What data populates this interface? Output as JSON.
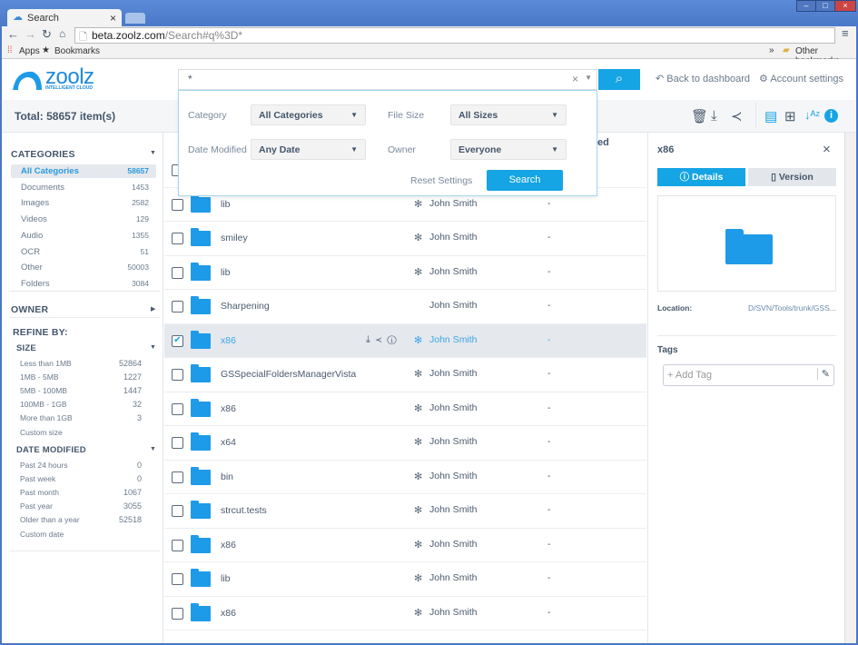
{
  "browser": {
    "tab_title": "Search",
    "url_host": "beta.zoolz.com",
    "url_path": "/Search#q%3D*",
    "bookmarks": [
      "Apps",
      "Bookmarks"
    ],
    "other_bookmarks": "Other bookmarks"
  },
  "header": {
    "logo": "zoolz",
    "logo_tag": "INTELLIGENT CLOUD",
    "search_value": "*",
    "back": "Back to dashboard",
    "account": "Account settings"
  },
  "toolbar": {
    "total_label": "Total:",
    "total_value": "58657 item(s)"
  },
  "filters": {
    "category_label": "Category",
    "category_value": "All Categories",
    "size_label": "File Size",
    "size_value": "All Sizes",
    "date_label": "Date Modified",
    "date_value": "Any Date",
    "owner_label": "Owner",
    "owner_value": "Everyone",
    "reset": "Reset Settings",
    "search": "Search",
    "col_partial": "ed"
  },
  "sidebar": {
    "categories_title": "CATEGORIES",
    "categories": [
      {
        "label": "All Categories",
        "count": "58657"
      },
      {
        "label": "Documents",
        "count": "1453"
      },
      {
        "label": "Images",
        "count": "2582"
      },
      {
        "label": "Videos",
        "count": "129"
      },
      {
        "label": "Audio",
        "count": "1355"
      },
      {
        "label": "OCR",
        "count": "51"
      },
      {
        "label": "Other",
        "count": "50003"
      },
      {
        "label": "Folders",
        "count": "3084"
      }
    ],
    "owner_title": "OWNER",
    "refine_title": "REFINE BY:",
    "size_title": "SIZE",
    "sizes": [
      {
        "label": "Less than 1MB",
        "count": "52864"
      },
      {
        "label": "1MB - 5MB",
        "count": "1227"
      },
      {
        "label": "5MB - 100MB",
        "count": "1447"
      },
      {
        "label": "100MB - 1GB",
        "count": "32"
      },
      {
        "label": "More than 1GB",
        "count": "3"
      },
      {
        "label": "Custom size",
        "count": ""
      }
    ],
    "date_title": "DATE MODIFIED",
    "dates": [
      {
        "label": "Past 24 hours",
        "count": "0"
      },
      {
        "label": "Past week",
        "count": "0"
      },
      {
        "label": "Past month",
        "count": "1067"
      },
      {
        "label": "Past year",
        "count": "3055"
      },
      {
        "label": "Older than a year",
        "count": "52518"
      },
      {
        "label": "Custom date",
        "count": ""
      }
    ]
  },
  "files": [
    {
      "name": "",
      "owner": "",
      "mod": "",
      "checked": false
    },
    {
      "name": "lib",
      "owner": "John Smith",
      "mod": "-",
      "checked": false
    },
    {
      "name": "smiley",
      "owner": "John Smith",
      "mod": "-",
      "checked": false
    },
    {
      "name": "lib",
      "owner": "John Smith",
      "mod": "-",
      "checked": false
    },
    {
      "name": "Sharpening",
      "owner": "John Smith",
      "mod": "-",
      "checked": false,
      "no_icon": true
    },
    {
      "name": "x86",
      "owner": "John Smith",
      "mod": "-",
      "checked": true
    },
    {
      "name": "GSSpecialFoldersManagerVista",
      "owner": "John Smith",
      "mod": "-",
      "checked": false
    },
    {
      "name": "x86",
      "owner": "John Smith",
      "mod": "-",
      "checked": false
    },
    {
      "name": "x64",
      "owner": "John Smith",
      "mod": "-",
      "checked": false
    },
    {
      "name": "bin",
      "owner": "John Smith",
      "mod": "-",
      "checked": false
    },
    {
      "name": "strcut.tests",
      "owner": "John Smith",
      "mod": "-",
      "checked": false
    },
    {
      "name": "x86",
      "owner": "John Smith",
      "mod": "-",
      "checked": false
    },
    {
      "name": "lib",
      "owner": "John Smith",
      "mod": "-",
      "checked": false
    },
    {
      "name": "x86",
      "owner": "John Smith",
      "mod": "-",
      "checked": false
    }
  ],
  "detail": {
    "title": "x86",
    "tab_details": "Details",
    "tab_version": "Version",
    "location_label": "Location:",
    "location_value": "D/SVN/Tools/trunk/GSS...",
    "tags_label": "Tags",
    "tag_placeholder": "+ Add Tag"
  },
  "colors": {
    "accent": "#15a4e4",
    "folder": "#1e9be8"
  }
}
